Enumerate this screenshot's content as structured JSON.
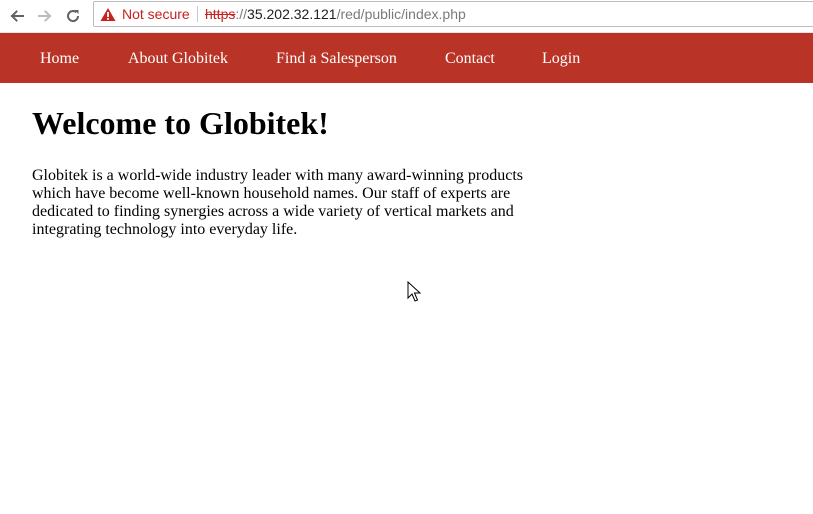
{
  "browser": {
    "security_label": "Not secure",
    "url_scheme": "https",
    "url_rest_host": "://35.202.32.121",
    "url_rest_path": "/red/public/index.php",
    "icons": [
      "back-icon",
      "forward-icon",
      "reload-icon",
      "warning-icon"
    ]
  },
  "nav": {
    "items": [
      {
        "label": "Home"
      },
      {
        "label": "About Globitek"
      },
      {
        "label": "Find a Salesperson"
      },
      {
        "label": "Contact"
      },
      {
        "label": "Login"
      }
    ],
    "background_color": "#b93426"
  },
  "main": {
    "heading": "Welcome to Globitek!",
    "intro": "Globitek is a world-wide industry leader with many award-winning products which have become well-known household names. Our staff of experts are dedicated to finding synergies across a wide variety of vertical markets and integrating technology into everyday life."
  }
}
